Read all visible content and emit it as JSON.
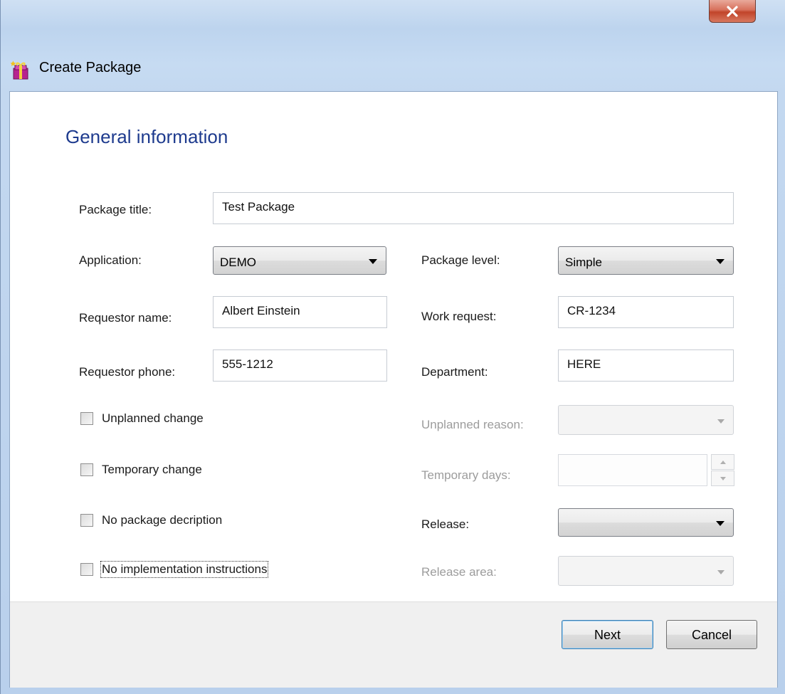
{
  "window": {
    "title": "Create Package",
    "app_icon": "package-gift-icon",
    "close_icon": "close-icon"
  },
  "form": {
    "heading": "General information",
    "package_title": {
      "label": "Package title:",
      "value": "Test Package"
    },
    "application": {
      "label": "Application:",
      "value": "DEMO"
    },
    "package_level": {
      "label": "Package level:",
      "value": "Simple"
    },
    "requestor_name": {
      "label": "Requestor name:",
      "value": "Albert Einstein"
    },
    "work_request": {
      "label": "Work request:",
      "value": "CR-1234"
    },
    "requestor_phone": {
      "label": "Requestor phone:",
      "value": "555-1212"
    },
    "department": {
      "label": "Department:",
      "value": "HERE"
    },
    "unplanned_change": {
      "label": "Unplanned change",
      "checked": false
    },
    "unplanned_reason": {
      "label": "Unplanned reason:",
      "value": "",
      "enabled": false
    },
    "temporary_change": {
      "label": "Temporary change",
      "checked": false
    },
    "temporary_days": {
      "label": "Temporary days:",
      "value": "",
      "enabled": false
    },
    "no_package_description": {
      "label": "No package decription",
      "checked": false
    },
    "release": {
      "label": "Release:",
      "value": ""
    },
    "no_implementation_instructions": {
      "label": "No implementation instructions",
      "checked": false,
      "focused": true
    },
    "release_area": {
      "label": "Release area:",
      "value": "",
      "enabled": false
    }
  },
  "buttons": {
    "next": "Next",
    "cancel": "Cancel"
  },
  "colors": {
    "heading": "#1e3b8e",
    "disabled_text": "#9c9c9c",
    "close_button": "#c1442a",
    "footer": "#f0f0f0"
  }
}
